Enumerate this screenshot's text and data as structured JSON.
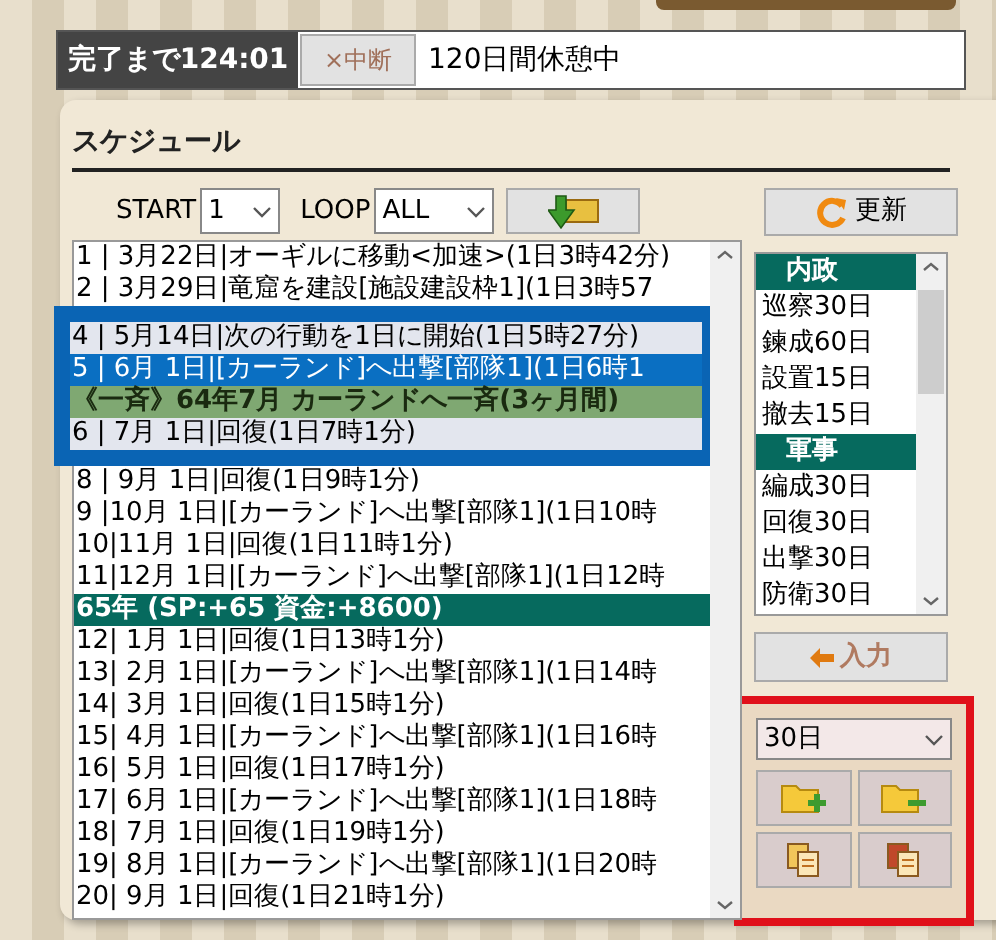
{
  "status_bar": {
    "countdown": "完了まで124:01",
    "cancel_button": "×中断",
    "message": "120日間休憩中"
  },
  "schedule": {
    "title": "スケジュール",
    "start_label": "START",
    "start_value": "1",
    "loop_label": "LOOP",
    "loop_value": "ALL",
    "refresh_button": "更新",
    "groups": [
      {
        "framed": false,
        "rows": [
          {
            "kind": "entry",
            "text": "1 | 3月22日|オーギルに移動<加速>(1日3時42分)",
            "selected": false
          },
          {
            "kind": "entry",
            "text": "2 | 3月29日|竜窟を建設[施設建設枠1](1日3時57",
            "selected": false
          }
        ]
      },
      {
        "framed": true,
        "rows": [
          {
            "kind": "entry",
            "text": "4 | 5月14日|次の行動を1日に開始(1日5時27分)",
            "selected": false
          },
          {
            "kind": "entry",
            "text": "5 | 6月 1日|[カーランド]へ出撃[部隊1](1日6時1",
            "selected": true
          },
          {
            "kind": "group",
            "text": "《一斉》64年7月 カーランドへ一斉(3ヶ月間)"
          },
          {
            "kind": "entry",
            "text": "6 | 7月 1日|回復(1日7時1分)",
            "selected": false
          }
        ]
      },
      {
        "framed": false,
        "rows": [
          {
            "kind": "entry",
            "text": "8 | 9月 1日|回復(1日9時1分)",
            "selected": false
          },
          {
            "kind": "entry",
            "text": "9 |10月 1日|[カーランド]へ出撃[部隊1](1日10時",
            "selected": false
          },
          {
            "kind": "entry",
            "text": "10|11月 1日|回復(1日11時1分)",
            "selected": false
          },
          {
            "kind": "entry",
            "text": "11|12月 1日|[カーランド]へ出撃[部隊1](1日12時",
            "selected": false
          },
          {
            "kind": "year",
            "text": "65年 (SP:+65 資金:+8600)"
          },
          {
            "kind": "entry",
            "text": "12| 1月 1日|回復(1日13時1分)",
            "selected": false
          },
          {
            "kind": "entry",
            "text": "13| 2月 1日|[カーランド]へ出撃[部隊1](1日14時",
            "selected": false
          },
          {
            "kind": "entry",
            "text": "14| 3月 1日|回復(1日15時1分)",
            "selected": false
          },
          {
            "kind": "entry",
            "text": "15| 4月 1日|[カーランド]へ出撃[部隊1](1日16時",
            "selected": false
          },
          {
            "kind": "entry",
            "text": "16| 5月 1日|回復(1日17時1分)",
            "selected": false
          },
          {
            "kind": "entry",
            "text": "17| 6月 1日|[カーランド]へ出撃[部隊1](1日18時",
            "selected": false
          },
          {
            "kind": "entry",
            "text": "18| 7月 1日|回復(1日19時1分)",
            "selected": false
          },
          {
            "kind": "entry",
            "text": "19| 8月 1日|[カーランド]へ出撃[部隊1](1日20時",
            "selected": false
          },
          {
            "kind": "entry",
            "text": "20| 9月 1日|回復(1日21時1分)",
            "selected": false
          }
        ]
      }
    ]
  },
  "actions": {
    "items": [
      {
        "kind": "header",
        "text": "内政"
      },
      {
        "kind": "item",
        "text": "巡察30日"
      },
      {
        "kind": "item",
        "text": "鍊成60日"
      },
      {
        "kind": "item",
        "text": "設置15日"
      },
      {
        "kind": "item",
        "text": "撤去15日"
      },
      {
        "kind": "header",
        "text": "軍事"
      },
      {
        "kind": "item",
        "text": "編成30日"
      },
      {
        "kind": "item",
        "text": "回復30日"
      },
      {
        "kind": "item",
        "text": "出撃30日"
      },
      {
        "kind": "item",
        "text": "防衛30日"
      }
    ],
    "input_button": "入力"
  },
  "tool_box": {
    "framed": true,
    "duration_value": "30日"
  }
}
